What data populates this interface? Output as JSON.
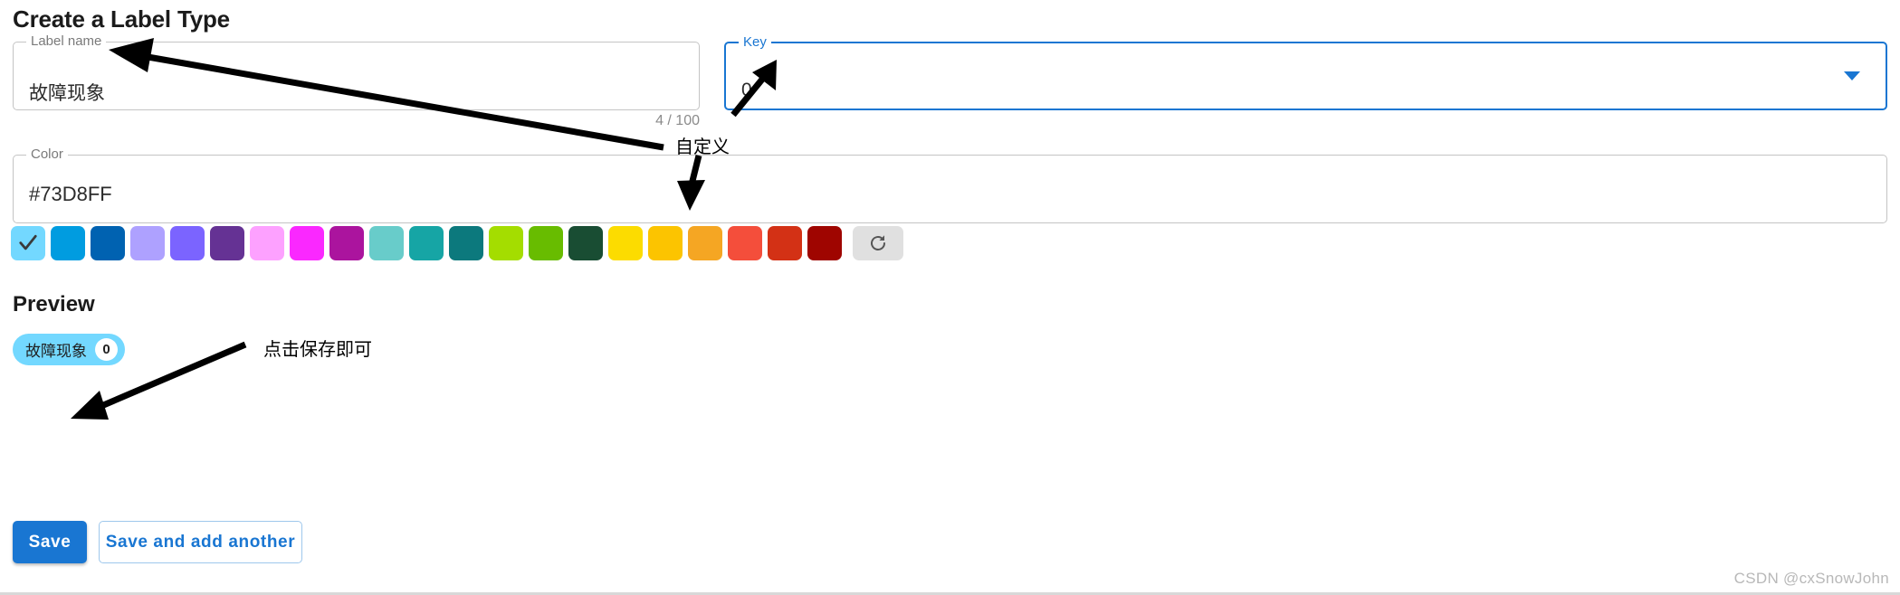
{
  "page_title": "Create a Label Type",
  "label_name": {
    "legend": "Label name",
    "value": "故障现象",
    "counter": "4 / 100"
  },
  "key": {
    "legend": "Key",
    "value": "0",
    "icon": "chevron-down-icon"
  },
  "color": {
    "legend": "Color",
    "value": "#73D8FF",
    "selected_index": 0,
    "refresh_icon": "refresh-icon",
    "swatches": [
      "#73D8FF",
      "#009CE0",
      "#0062B1",
      "#AEA1FF",
      "#7B64FF",
      "#653294",
      "#FDA1FF",
      "#FA28FF",
      "#AB149E",
      "#68CCCA",
      "#16A5A5",
      "#0C797D",
      "#A4DD00",
      "#68BC00",
      "#194D33",
      "#FCDC00",
      "#FCC400",
      "#F5A623",
      "#F44E3B",
      "#D33115",
      "#9F0500"
    ]
  },
  "preview": {
    "title": "Preview",
    "chip_label": "故障现象",
    "chip_badge": "0",
    "chip_color": "#73D8FF"
  },
  "buttons": {
    "save": "Save",
    "save_and_add_another": "Save and add another"
  },
  "annotations": {
    "custom": "自定义",
    "save_hint": "点击保存即可"
  },
  "watermark": "CSDN @cxSnowJohn",
  "accent_color": "#1976d2"
}
